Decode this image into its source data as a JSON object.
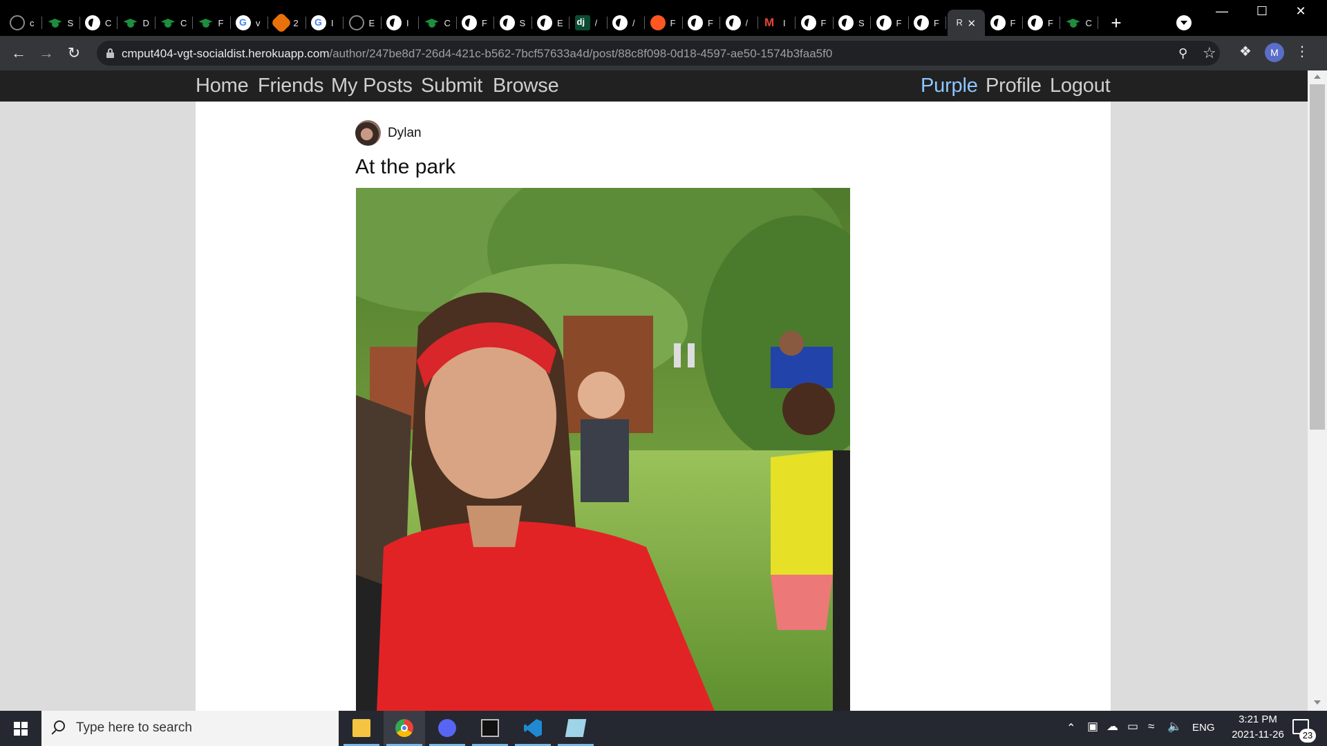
{
  "browser": {
    "tabs": [
      {
        "favicon": "github-icon",
        "letter": "c"
      },
      {
        "favicon": "graduation-cap-icon",
        "letter": "S"
      },
      {
        "favicon": "globe-icon",
        "letter": "C"
      },
      {
        "favicon": "graduation-cap-icon",
        "letter": "D"
      },
      {
        "favicon": "graduation-cap-icon",
        "letter": "C"
      },
      {
        "favicon": "graduation-cap-icon",
        "letter": "F"
      },
      {
        "favicon": "google-icon",
        "letter": "v"
      },
      {
        "favicon": "sun-icon",
        "letter": "2"
      },
      {
        "favicon": "google-icon",
        "letter": "I"
      },
      {
        "favicon": "github-icon",
        "letter": "E"
      },
      {
        "favicon": "globe-icon",
        "letter": "I"
      },
      {
        "favicon": "graduation-cap-icon",
        "letter": "C"
      },
      {
        "favicon": "globe-icon",
        "letter": "F"
      },
      {
        "favicon": "globe-icon",
        "letter": "S"
      },
      {
        "favicon": "globe-icon",
        "letter": "E"
      },
      {
        "favicon": "django-icon",
        "letter": "/"
      },
      {
        "favicon": "globe-icon",
        "letter": "/"
      },
      {
        "favicon": "orange-circle-icon",
        "letter": "F"
      },
      {
        "favicon": "globe-icon",
        "letter": "F"
      },
      {
        "favicon": "globe-icon",
        "letter": "/"
      },
      {
        "favicon": "gmail-icon",
        "letter": "I"
      },
      {
        "favicon": "globe-icon",
        "letter": "F"
      },
      {
        "favicon": "globe-icon",
        "letter": "S"
      },
      {
        "favicon": "globe-icon",
        "letter": "F"
      },
      {
        "favicon": "globe-icon",
        "letter": "F"
      },
      {
        "favicon": "",
        "letter": "R",
        "active": true
      },
      {
        "favicon": "globe-icon",
        "letter": "F"
      },
      {
        "favicon": "globe-icon",
        "letter": "F"
      },
      {
        "favicon": "graduation-cap-icon",
        "letter": "C"
      }
    ],
    "active_tab_close": "✕",
    "new_tab": "+",
    "window_controls": {
      "minimize": "—",
      "maximize": "☐",
      "close": "✕"
    },
    "url_host": "cmput404-vgt-socialdist.herokuapp.com",
    "url_path": "/author/247be8d7-26d4-421c-b562-7bcf57633a4d/post/88c8f098-0d18-4597-ae50-1574b3faa5f0",
    "profile_initial": "M"
  },
  "site": {
    "nav_left": [
      "Home",
      "Friends",
      "My Posts",
      "Submit",
      "Browse"
    ],
    "nav_right": [
      "Purple",
      "Profile",
      "Logout"
    ],
    "nav_highlight": "Purple",
    "highlight_color": "#8ec5ff"
  },
  "post": {
    "author": "Dylan",
    "title": "At the park"
  },
  "taskbar": {
    "search_placeholder": "Type here to search",
    "apps": [
      "file-explorer-icon",
      "chrome-icon",
      "discord-icon",
      "terminal-icon",
      "vscode-icon",
      "notepad-icon"
    ],
    "language": "ENG",
    "time": "3:21 PM",
    "date": "2021-11-26",
    "notification_count": "23"
  }
}
